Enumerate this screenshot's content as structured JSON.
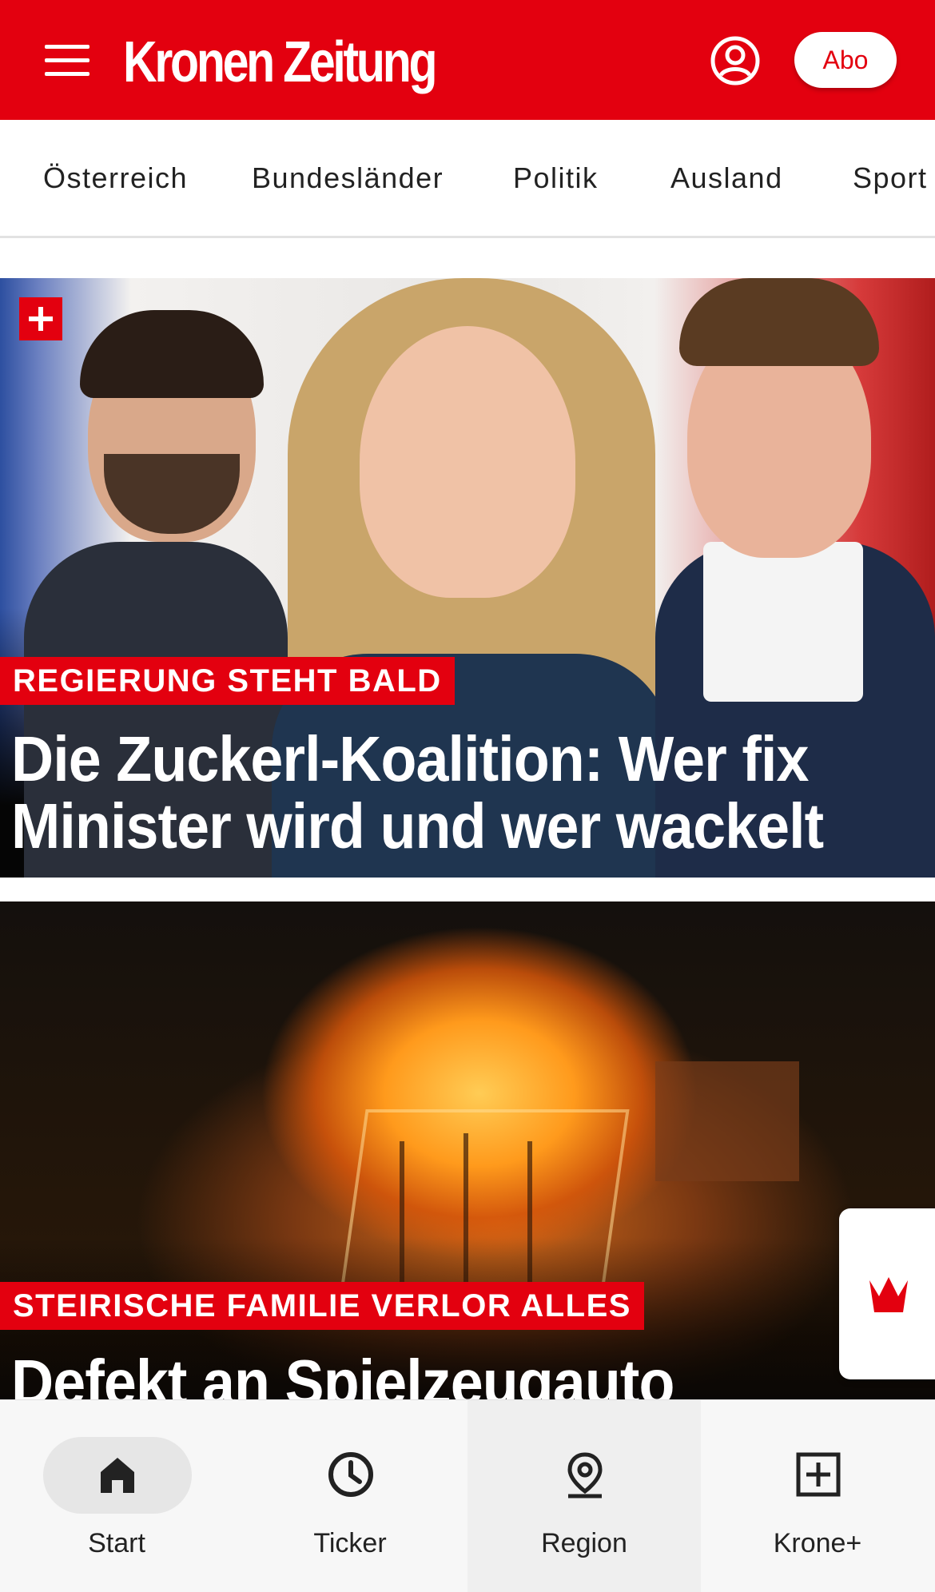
{
  "header": {
    "brand": "Kronen Zeitung",
    "subscribe_label": "Abo",
    "brand_color": "#e3000f"
  },
  "nav": {
    "items": [
      "Österreich",
      "Bundesländer",
      "Politik",
      "Ausland",
      "Sport"
    ]
  },
  "articles": [
    {
      "kicker": "REGIERUNG STEHT BALD",
      "headline_line1": "Die Zuckerl-Koalition: Wer fix",
      "headline_line2": "Minister wird und wer wackelt",
      "premium_icon": "plus-badge-icon"
    },
    {
      "kicker": "STEIRISCHE FAMILIE VERLOR ALLES",
      "headline_line1": "Defekt an Spielzeugauto"
    }
  ],
  "floating_widget": {
    "icon": "crown-icon"
  },
  "bottom_nav": {
    "items": [
      {
        "label": "Start",
        "icon": "home-icon",
        "selected": true
      },
      {
        "label": "Ticker",
        "icon": "clock-icon"
      },
      {
        "label": "Region",
        "icon": "location-pin-icon"
      },
      {
        "label": "Krone+",
        "icon": "plus-box-icon"
      }
    ]
  }
}
